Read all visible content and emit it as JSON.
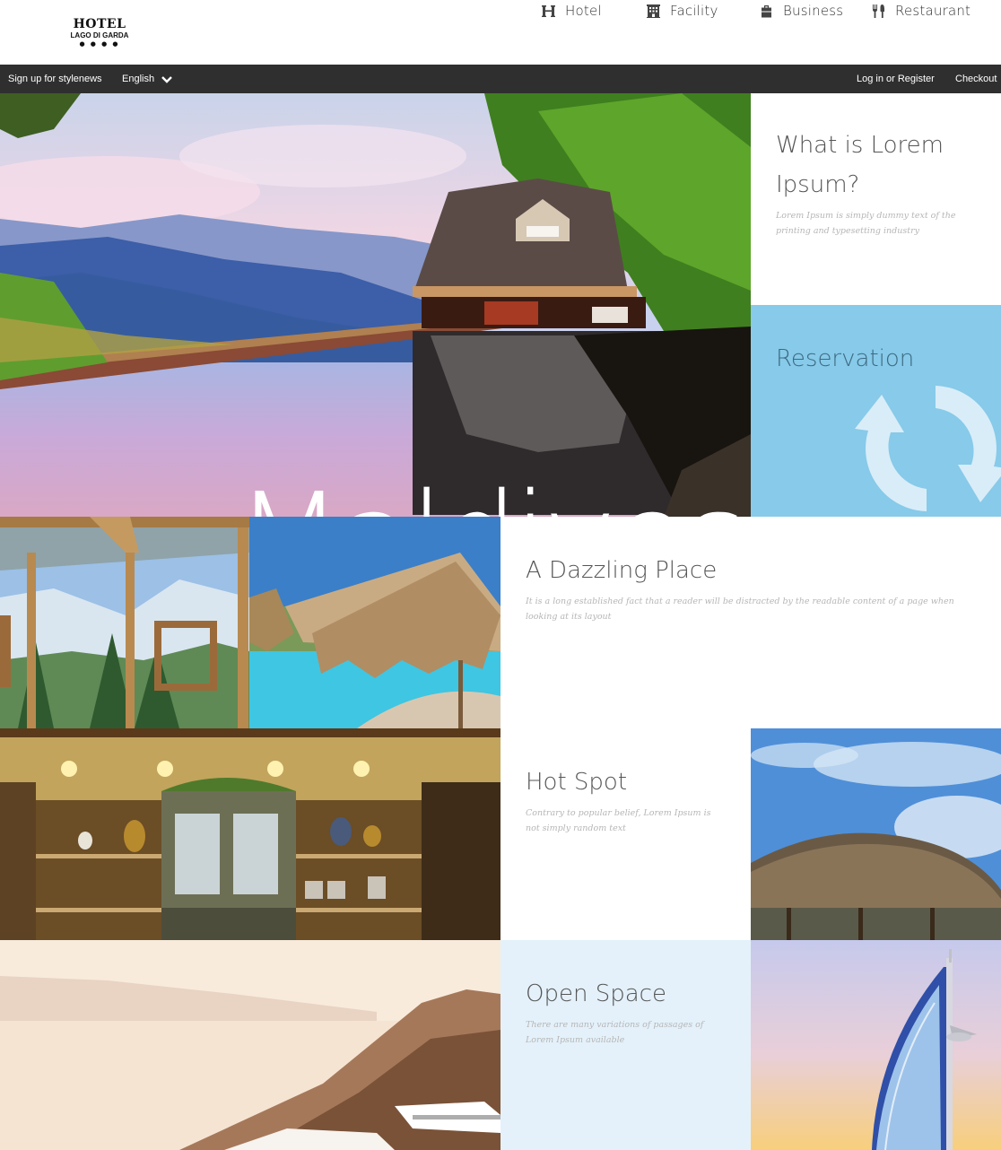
{
  "brand": {
    "line1": "HOTEL",
    "line2": "LAGO DI GARDA",
    "stars": "● ● ● ●"
  },
  "nav": [
    {
      "label": "Hotel",
      "icon": "hotel-h-icon"
    },
    {
      "label": "Facility",
      "icon": "building-icon"
    },
    {
      "label": "Business",
      "icon": "briefcase-icon"
    },
    {
      "label": "Restaurant",
      "icon": "cutlery-icon"
    }
  ],
  "topbar": {
    "signup": "Sign up for stylenews",
    "language": "English",
    "login": "Log in or Register",
    "checkout": "Checkout"
  },
  "hero": {
    "title": "Maldives"
  },
  "tiles": {
    "what": {
      "title": "What is Lorem Ipsum?",
      "text": "Lorem Ipsum is simply dummy text of the printing and typesetting industry"
    },
    "reservation": {
      "title": "Reservation",
      "icon": "refresh-icon",
      "color": "#87cae9"
    },
    "dazzling": {
      "title": "A Dazzling Place",
      "text": "It is a long established fact that a reader will be distracted by the readable content of a page when looking at its layout"
    },
    "hotspot": {
      "title": "Hot Spot",
      "text": "Contrary to popular belief, Lorem Ipsum is not simply random text"
    },
    "openspace": {
      "title": "Open Space",
      "text": "There are many variations of passages of Lorem Ipsum available",
      "color": "#e4f1fa"
    }
  }
}
